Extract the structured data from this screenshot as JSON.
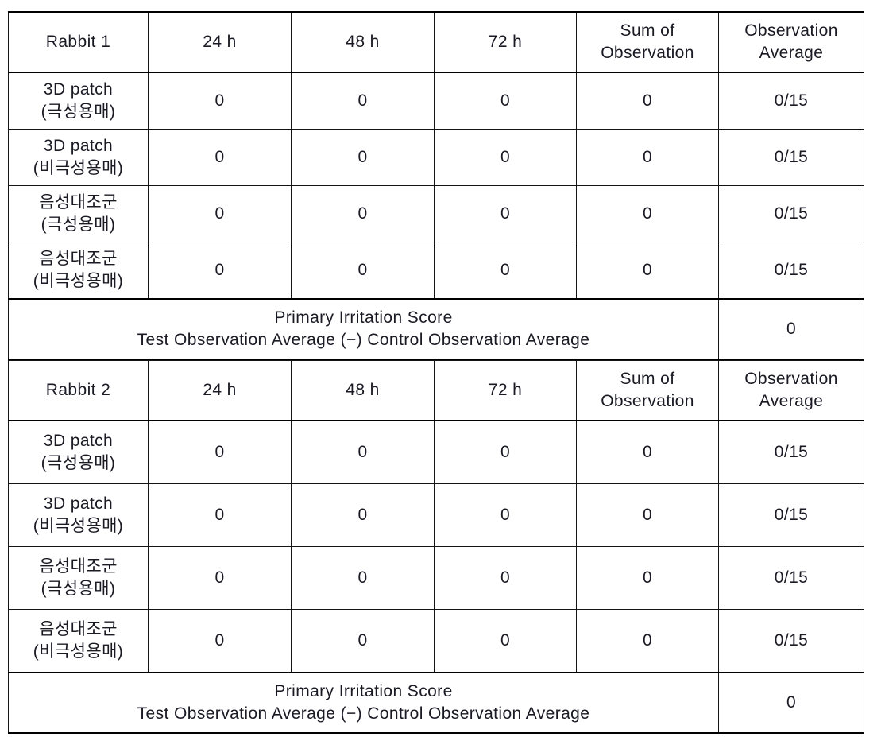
{
  "colors": {
    "header_fill": "#e2e2e2",
    "border": "#141414",
    "rule": "#000000",
    "text": "#1a1a24"
  },
  "tables": [
    {
      "id": "rabbit-1",
      "headers": [
        "Rabbit 1",
        "24 h",
        "48 h",
        "72 h",
        "Sum of\nObservation",
        "Observation\nAverage"
      ],
      "header_cells": [
        {
          "line1": "Rabbit 1",
          "line2": ""
        },
        {
          "line1": "24 h",
          "line2": ""
        },
        {
          "line1": "48 h",
          "line2": ""
        },
        {
          "line1": "72 h",
          "line2": ""
        },
        {
          "line1": "Sum of",
          "line2": "Observation"
        },
        {
          "line1": "Observation",
          "line2": "Average"
        }
      ],
      "rows": [
        {
          "label_line1": "3D patch",
          "label_line2": "(극성용매)",
          "h24": "0",
          "h48": "0",
          "h72": "0",
          "sum": "0",
          "avg": "0/15"
        },
        {
          "label_line1": "3D patch",
          "label_line2": "(비극성용매)",
          "h24": "0",
          "h48": "0",
          "h72": "0",
          "sum": "0",
          "avg": "0/15"
        },
        {
          "label_line1": "음성대조군",
          "label_line2": "(극성용매)",
          "h24": "0",
          "h48": "0",
          "h72": "0",
          "sum": "0",
          "avg": "0/15"
        },
        {
          "label_line1": "음성대조군",
          "label_line2": "(비극성용매)",
          "h24": "0",
          "h48": "0",
          "h72": "0",
          "sum": "0",
          "avg": "0/15"
        }
      ],
      "score": {
        "line1": "Primary Irritation Score",
        "line2": "Test Observation Average (−) Control Observation Average",
        "value": "0"
      }
    },
    {
      "id": "rabbit-2",
      "headers": [
        "Rabbit 2",
        "24 h",
        "48 h",
        "72 h",
        "Sum of\nObservation",
        "Observation\nAverage"
      ],
      "header_cells": [
        {
          "line1": "Rabbit 2",
          "line2": ""
        },
        {
          "line1": "24 h",
          "line2": ""
        },
        {
          "line1": "48 h",
          "line2": ""
        },
        {
          "line1": "72 h",
          "line2": ""
        },
        {
          "line1": "Sum of",
          "line2": "Observation"
        },
        {
          "line1": "Observation",
          "line2": "Average"
        }
      ],
      "rows": [
        {
          "label_line1": "3D patch",
          "label_line2": "(극성용매)",
          "h24": "0",
          "h48": "0",
          "h72": "0",
          "sum": "0",
          "avg": "0/15"
        },
        {
          "label_line1": "3D patch",
          "label_line2": "(비극성용매)",
          "h24": "0",
          "h48": "0",
          "h72": "0",
          "sum": "0",
          "avg": "0/15"
        },
        {
          "label_line1": "음성대조군",
          "label_line2": "(극성용매)",
          "h24": "0",
          "h48": "0",
          "h72": "0",
          "sum": "0",
          "avg": "0/15"
        },
        {
          "label_line1": "음성대조군",
          "label_line2": "(비극성용매)",
          "h24": "0",
          "h48": "0",
          "h72": "0",
          "sum": "0",
          "avg": "0/15"
        }
      ],
      "score": {
        "line1": "Primary Irritation Score",
        "line2": "Test Observation Average (−) Control Observation Average",
        "value": "0"
      }
    }
  ]
}
